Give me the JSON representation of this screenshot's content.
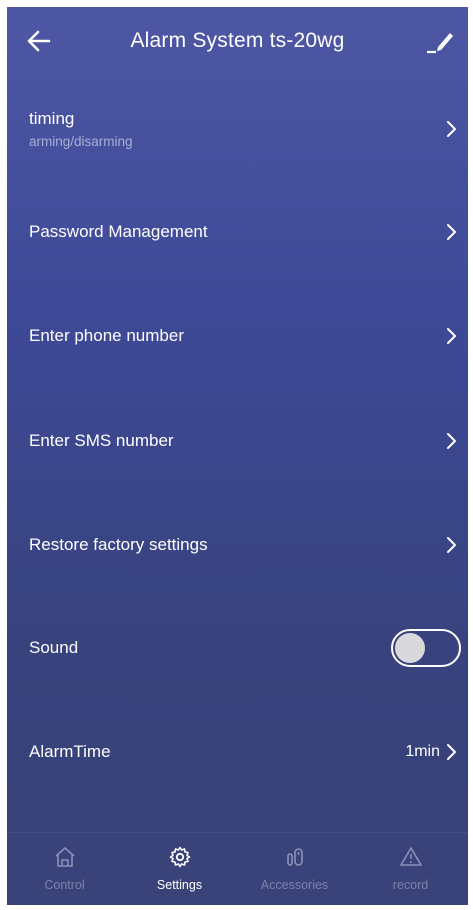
{
  "header": {
    "title": "Alarm System ts-20wg",
    "back_icon": "arrow-left-icon",
    "edit_icon": "pencil-icon"
  },
  "settings": {
    "timing": {
      "label": "timing",
      "sublabel": "arming/disarming"
    },
    "password": {
      "label": "Password Management"
    },
    "phone": {
      "label": "Enter phone number"
    },
    "sms": {
      "label": "Enter SMS number"
    },
    "factory": {
      "label": "Restore factory settings"
    },
    "sound": {
      "label": "Sound",
      "enabled": false
    },
    "alarm_time": {
      "label": "AlarmTime",
      "value": "1min"
    }
  },
  "tabbar": {
    "tabs": [
      {
        "label": "Control",
        "icon": "home-icon",
        "active": false
      },
      {
        "label": "Settings",
        "icon": "gear-icon",
        "active": true
      },
      {
        "label": "Accessories",
        "icon": "sensor-icon",
        "active": false
      },
      {
        "label": "record",
        "icon": "warning-icon",
        "active": false
      }
    ]
  },
  "colors": {
    "background_top": "#4d57a4",
    "background_bottom": "#384176",
    "text": "#ffffff",
    "subtext": "#a8aed6",
    "tab_inactive": "#7b82ad",
    "tab_active": "#ffffff"
  }
}
